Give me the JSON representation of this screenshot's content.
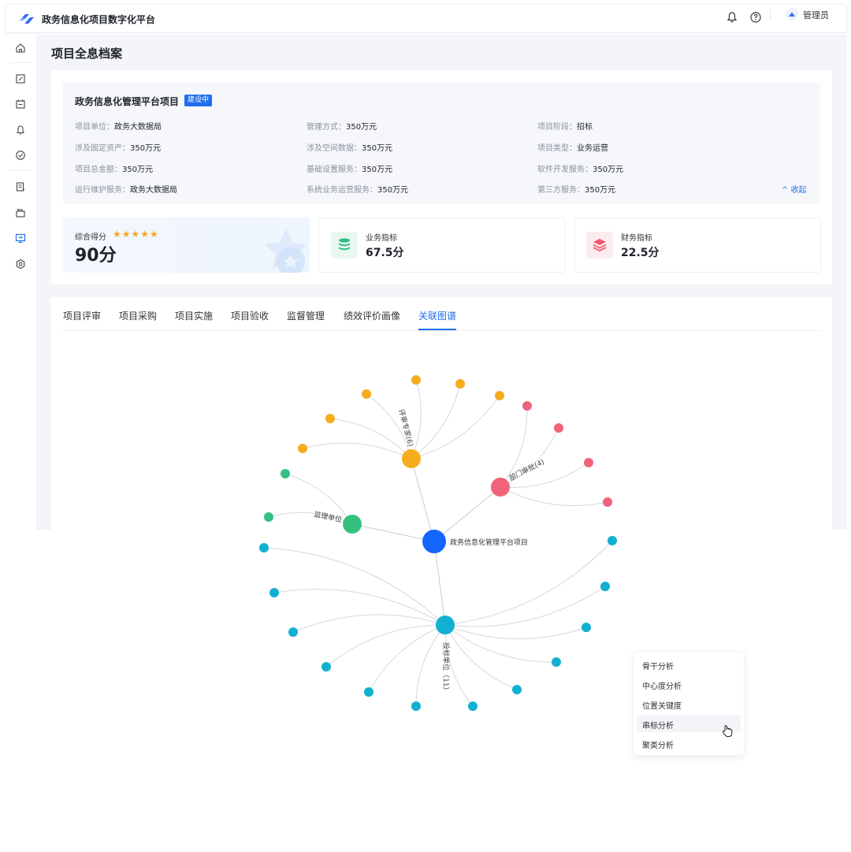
{
  "app": {
    "title": "政务信息化项目数字化平台",
    "user": "管理员"
  },
  "page": {
    "title": "项目全息档案"
  },
  "project": {
    "name": "政务信息化管理平台项目",
    "status": "建设中",
    "fields": [
      {
        "key": "项目单位：",
        "value": "政务大数据局"
      },
      {
        "key": "管理方式：",
        "value": "350万元"
      },
      {
        "key": "项目阶段：",
        "value": "招标"
      },
      {
        "key": "涉及固定资产：",
        "value": "350万元"
      },
      {
        "key": "涉及空间数据：",
        "value": "350万元"
      },
      {
        "key": "项目类型：",
        "value": "业务运营"
      },
      {
        "key": "项目总金额：",
        "value": "350万元"
      },
      {
        "key": "基础设置服务：",
        "value": "350万元"
      },
      {
        "key": "软件开发服务：",
        "value": "350万元"
      },
      {
        "key": "运行维护服务：",
        "value": "政务大数据局"
      },
      {
        "key": "系统业务运营服务：",
        "value": "350万元"
      },
      {
        "key": "第三方服务：",
        "value": "350万元"
      }
    ],
    "collapse_label": "收起"
  },
  "score": {
    "label": "综合得分",
    "stars": "★★★★★",
    "value": "90分"
  },
  "metrics": [
    {
      "label": "业务指标",
      "value": "67.5分",
      "color": "#2dbf7e"
    },
    {
      "label": "财务指标",
      "value": "22.5分",
      "color": "#f0566d"
    }
  ],
  "tabs": [
    {
      "label": "项目评审"
    },
    {
      "label": "项目采购"
    },
    {
      "label": "项目实施"
    },
    {
      "label": "项目验收"
    },
    {
      "label": "监督管理"
    },
    {
      "label": "绩效评价画像"
    },
    {
      "label": "关联图谱",
      "active": true
    }
  ],
  "graph": {
    "center_label": "政务信息化管理平台项目",
    "hubs": [
      {
        "label": "评审专家(6)",
        "color": "#f5ac1d"
      },
      {
        "label": "部门审批(4)",
        "color": "#f0637a"
      },
      {
        "label": "监理单位",
        "color": "#34c17f"
      },
      {
        "label": "投标单位（11）",
        "color": "#11b0d1"
      }
    ],
    "center_color": "#1565ff"
  },
  "context_menu": {
    "items": [
      "骨干分析",
      "中心度分析",
      "位置关键度",
      "串标分析",
      "聚类分析"
    ],
    "hovered": "串标分析"
  }
}
